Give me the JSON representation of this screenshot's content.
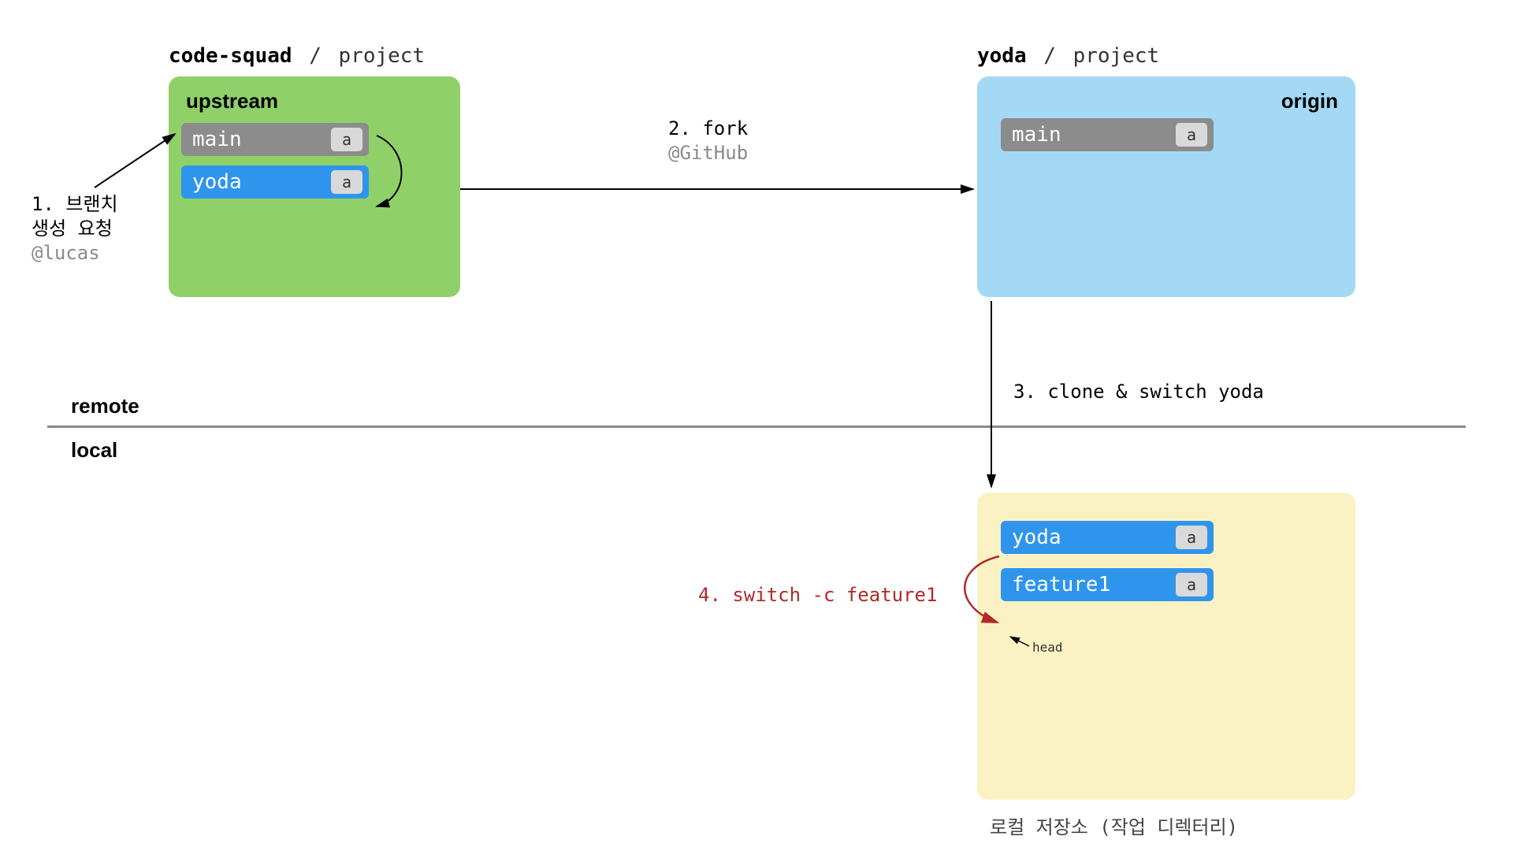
{
  "upstream": {
    "owner": "code-squad",
    "name": "project",
    "label": "upstream",
    "branches": [
      {
        "name": "main",
        "commit": "a",
        "color": "gray"
      },
      {
        "name": "yoda",
        "commit": "a",
        "color": "blue"
      }
    ]
  },
  "origin": {
    "owner": "yoda",
    "name": "project",
    "label": "origin",
    "branches": [
      {
        "name": "main",
        "commit": "a",
        "color": "gray"
      }
    ]
  },
  "local": {
    "caption": "로컬 저장소 (작업 디렉터리)",
    "branches": [
      {
        "name": "yoda",
        "commit": "a",
        "color": "blue"
      },
      {
        "name": "feature1",
        "commit": "a",
        "color": "blue"
      }
    ],
    "head_label": "head"
  },
  "sections": {
    "remote": "remote",
    "local": "local"
  },
  "steps": {
    "s1_line1": "1. 브랜치",
    "s1_line2": "생성 요청",
    "s1_mention": "@lucas",
    "s2_line1": "2. fork",
    "s2_mention": "@GitHub",
    "s3": "3. clone & switch yoda",
    "s4": "4. switch -c feature1"
  }
}
